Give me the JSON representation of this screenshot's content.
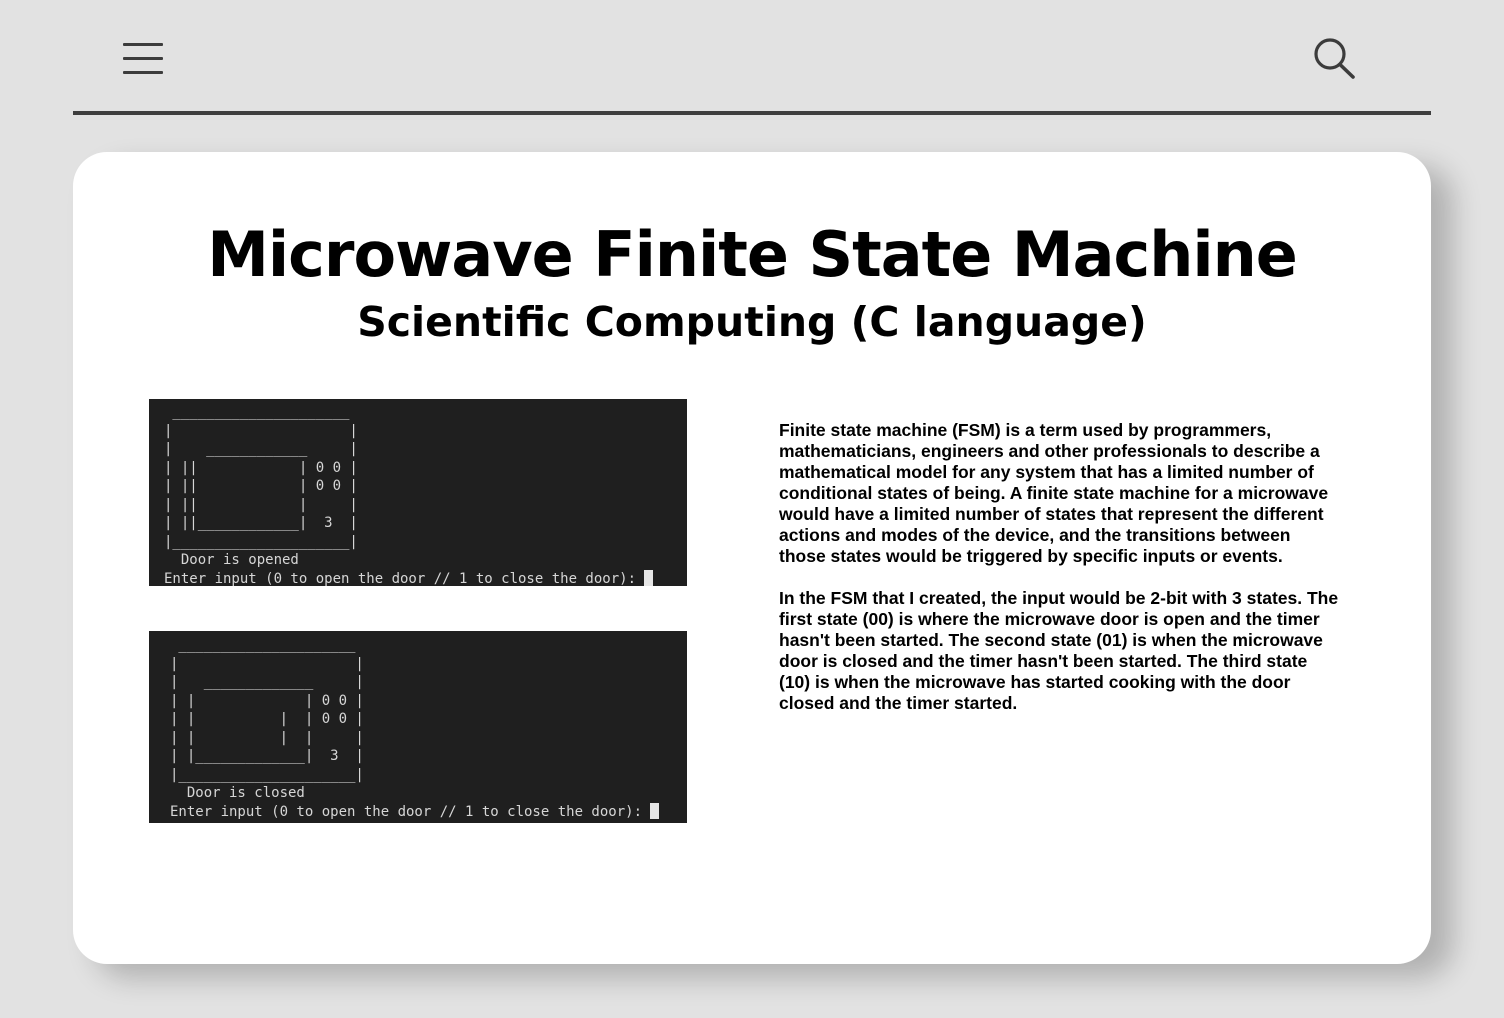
{
  "header": {
    "menu_icon": "hamburger-menu-icon",
    "search_icon": "magnifier-search-icon"
  },
  "colors": {
    "background": "#e2e2e2",
    "card": "#ffffff",
    "terminal_bg": "#1f1f1f",
    "terminal_text": "#d6d6d6",
    "divider": "#3e3e3e"
  },
  "card": {
    "title": "Microwave Finite State Machine",
    "subtitle": "Scientific Computing (C language)"
  },
  "terminals": [
    {
      "art": " _____________________\n|                     |\n|    ____________     |\n| ||            | 0 0 |\n| ||            | 0 0 |\n| ||            |     |\n| ||____________|  3  |\n|_____________________|",
      "status": "  Door is opened",
      "prompt": "Enter input (0 to open the door // 1 to close the door): "
    },
    {
      "art": " _____________________\n|                     |\n|   _____________     |\n| |             | 0 0 |\n| |          |  | 0 0 |\n| |          |  |     |\n| |_____________|  3  |\n|_____________________|",
      "status": "  Door is closed",
      "prompt": "Enter input (0 to open the door // 1 to close the door): "
    }
  ],
  "description": {
    "paragraph_1": "Finite state machine (FSM) is a term used by programmers, mathematicians, engineers and other professionals to describe a mathematical model for any system that has a limited number of conditional states of being. A finite state machine for a microwave would have a limited number of states that represent the different actions and modes of the device, and the transitions between those states would be triggered by specific inputs or events.",
    "paragraph_2": "In the FSM that I created, the input would be 2-bit with 3 states. The first state (00) is where the microwave door is open and the timer hasn't been started. The second state (01) is when the microwave door is closed and the timer hasn't been started. The third state (10) is when the microwave has started cooking with the door closed and the timer started."
  }
}
